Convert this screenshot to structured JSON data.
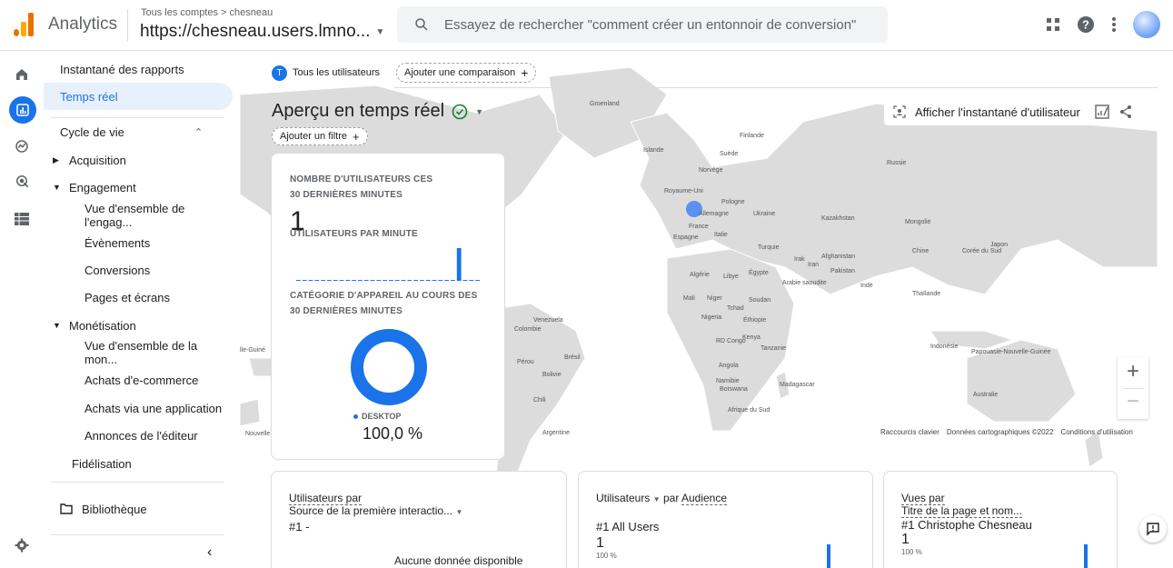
{
  "header": {
    "app_name": "Analytics",
    "breadcrumb": "Tous les comptes > chesneau",
    "property": "https://chesneau.users.lmno...",
    "search_placeholder": "Essayez de rechercher \"comment créer un entonnoir de conversion\""
  },
  "sidebar": {
    "items": [
      {
        "label": "Instantané des rapports"
      },
      {
        "label": "Temps réel"
      },
      {
        "label": "Cycle de vie"
      },
      {
        "label": "Acquisition"
      },
      {
        "label": "Engagement"
      },
      {
        "label": "Vue d'ensemble de l'engag..."
      },
      {
        "label": "Évènements"
      },
      {
        "label": "Conversions"
      },
      {
        "label": "Pages et écrans"
      },
      {
        "label": "Monétisation"
      },
      {
        "label": "Vue d'ensemble de la mon..."
      },
      {
        "label": "Achats d'e-commerce"
      },
      {
        "label": "Achats via une application"
      },
      {
        "label": "Annonces de l'éditeur"
      },
      {
        "label": "Fidélisation"
      },
      {
        "label": "Bibliothèque"
      }
    ]
  },
  "main": {
    "audience_chip": "Tous les utilisateurs",
    "audience_chip_letter": "T",
    "compare_chip": "Ajouter une comparaison",
    "title": "Aperçu en temps réel",
    "filter_chip": "Ajouter un filtre",
    "snapshot_button": "Afficher l'instantané d'utilisateur"
  },
  "realtime_card": {
    "users_label_1": "NOMBRE D'UTILISATEURS CES",
    "users_label_2": "30 DERNIÈRES MINUTES",
    "users_value": "1",
    "per_minute_label": "UTILISATEURS PAR MINUTE",
    "per_minute_values": [
      0,
      0,
      0,
      0,
      0,
      0,
      0,
      0,
      0,
      0,
      0,
      0,
      0,
      0,
      0,
      0,
      0,
      0,
      0,
      0,
      0,
      0,
      0,
      0,
      0,
      0,
      1,
      0,
      0,
      0
    ],
    "device_label_1": "CATÉGORIE D'APPAREIL AU COURS DES",
    "device_label_2": "30 DERNIÈRES MINUTES",
    "device_legend": "DESKTOP",
    "device_percent": "100,0 %",
    "device_fraction": 1.0
  },
  "map": {
    "labels": {
      "greenland": "Groenland",
      "iceland": "Islande",
      "finland": "Finlande",
      "sweden": "Suède",
      "norway": "Norvège",
      "russia": "Russie",
      "uk": "Royaume-Uni",
      "poland": "Pologne",
      "germany": "Allemagne",
      "ukraine": "Ukraine",
      "france": "France",
      "kazakhstan": "Kazakhstan",
      "mongolia": "Mongolie",
      "italy": "Italie",
      "spain": "Espagne",
      "turkey": "Turquie",
      "china": "Chine",
      "korea": "Corée du Sud",
      "japan": "Japon",
      "iraq": "Irak",
      "iran": "Iran",
      "afghanistan": "Afghanistan",
      "pakistan": "Pakistan",
      "algeria": "Algérie",
      "libya": "Libye",
      "egypt": "Égypte",
      "saudi": "Arabie saoudite",
      "india": "Inde",
      "thailand": "Thaïlande",
      "mali": "Mali",
      "niger": "Niger",
      "chad": "Tchad",
      "sudan": "Soudan",
      "nigeria": "Nigeria",
      "ethiopia": "Éthiopie",
      "venezuela": "Venezuela",
      "colombia": "Colombie",
      "kenya": "Kenya",
      "drc": "RD Congo",
      "tanzania": "Tanzanie",
      "indonesia": "Indonésie",
      "png": "Papouasie-Nouvelle-Guinée",
      "peru": "Pérou",
      "brazil": "Brésil",
      "bolivia": "Bolivie",
      "angola": "Angola",
      "namibia": "Namibie",
      "botswana": "Botswana",
      "madagascar": "Madagascar",
      "chile": "Chili",
      "south_africa": "Afrique du Sud",
      "australia": "Australie",
      "argentina": "Argentine",
      "nz": "Nouvelle-Zélande",
      "png_left": "lle-Guiné",
      "nz_left": "Nouvelle"
    },
    "attribution": {
      "shortcuts": "Raccourcis clavier",
      "data": "Données cartographiques ©2022",
      "terms": "Conditions d'utilisation"
    }
  },
  "bottom_cards": [
    {
      "metric": "Utilisateurs par",
      "dimension": "Source de la première interactio...",
      "rank": "#1",
      "top_value": "-",
      "empty_text": "Aucune donnée disponible"
    },
    {
      "metric": "Utilisateurs",
      "connector": "par",
      "dimension": "Audience",
      "rank": "#1",
      "top_value": "All Users",
      "value": "1",
      "percent": "100 %"
    },
    {
      "metric": "Vues par",
      "dimension": "Titre de la page et nom...",
      "rank": "#1",
      "top_value": "Christophe Chesneau",
      "value": "1",
      "percent": "100 %"
    }
  ],
  "colors": {
    "accent": "#1a73e8",
    "nav_active_bg": "#e8f0fe",
    "map_land": "#dcdcdc",
    "logo_orange": "#f9ab00",
    "logo_dark": "#e37400"
  },
  "icons": {
    "home": "home-icon",
    "reports": "reports-icon",
    "explore": "explore-icon",
    "advertising": "advertising-icon",
    "configure": "table-icon",
    "admin": "gear-icon"
  }
}
